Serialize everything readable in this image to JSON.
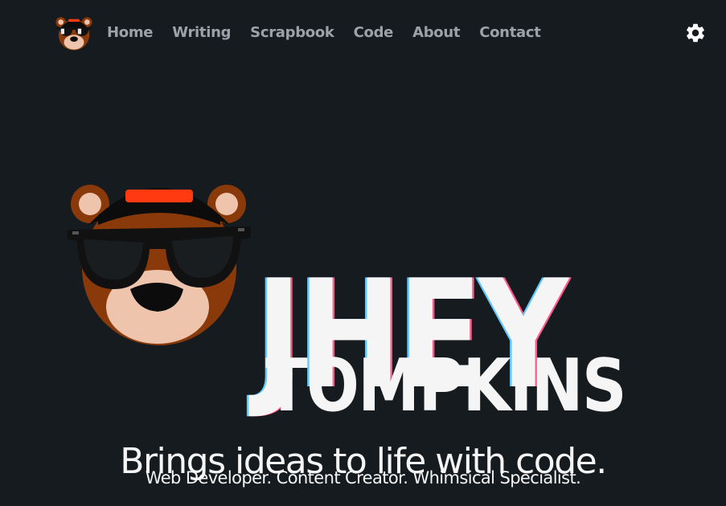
{
  "nav": {
    "items": [
      {
        "label": "Home"
      },
      {
        "label": "Writing"
      },
      {
        "label": "Scrapbook"
      },
      {
        "label": "Code"
      },
      {
        "label": "About"
      },
      {
        "label": "Contact"
      }
    ]
  },
  "icons": {
    "logo": "bear-mascot-icon",
    "settings": "gear-icon",
    "hero_mascot": "bear-mascot-icon"
  },
  "hero": {
    "first_name": "JHEY",
    "last_name": "TOMPKINS",
    "tagline": "Brings ideas to life with code.",
    "subtitle": "Web Developer. Content Creator. Whimsical Specialist."
  },
  "colors": {
    "background": "#151b1f",
    "nav_text": "#9ba3a8",
    "text": "#f5f5f5",
    "bear_fur": "#8a3a0a",
    "bear_muzzle": "#eec4ad",
    "cap": "#0c0c0c",
    "cap_band": "#ff3a10",
    "glasses": "#111111"
  }
}
